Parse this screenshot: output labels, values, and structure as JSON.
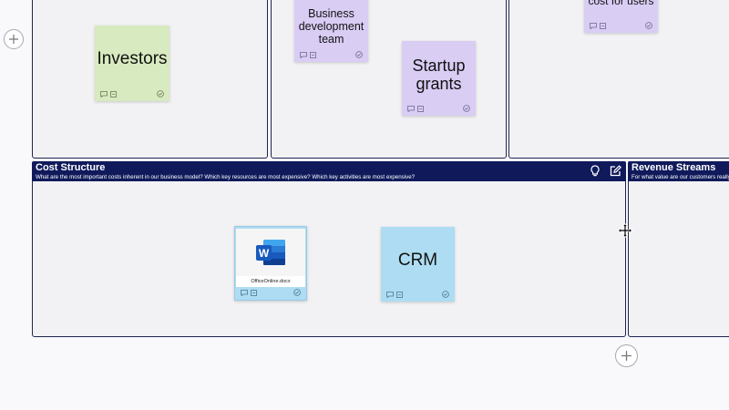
{
  "stickies": {
    "investors": "Investors",
    "business_dev": "Business development team",
    "startup_grants": "Startup grants",
    "cut_top": "cost for users",
    "crm": "CRM"
  },
  "cost_structure": {
    "title": "Cost Structure",
    "subtitle": "What are the most important costs inherent in our business model? Which key resources are most expensive? Which key activities are most expensive?"
  },
  "revenue_streams": {
    "title": "Revenue Streams",
    "subtitle": "For what value are our customers really willing to pay?"
  },
  "file_card": {
    "filename": "OfficeOnline.docx",
    "icon": "word-icon",
    "badge_letter": "W"
  },
  "icons": {
    "add": "plus-icon",
    "comment": "comment-icon",
    "vote": "checkmark-icon",
    "idea": "lightbulb-icon",
    "edit": "edit-icon",
    "move": "move-icon"
  },
  "colors": {
    "header_bg": "#101a5b",
    "sticky_green": "#d8eabf",
    "sticky_purple": "#d9cdf4",
    "sticky_blue": "#aedcf2"
  }
}
